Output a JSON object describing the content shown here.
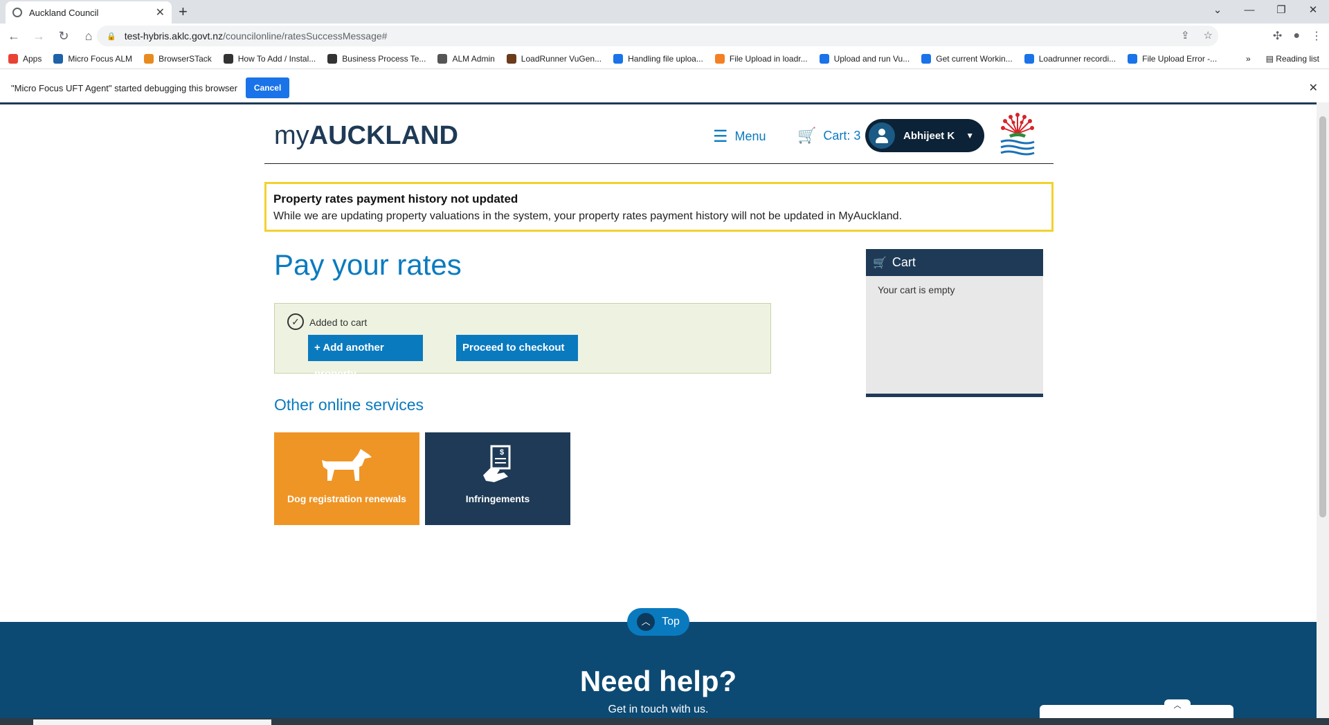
{
  "browser": {
    "tab_title": "Auckland Council",
    "url_host": "test-hybris.aklc.govt.nz",
    "url_path": "/councilonline/ratesSuccessMessage#",
    "bookmarks": [
      {
        "label": "Apps",
        "color": "#e94235"
      },
      {
        "label": "Micro Focus ALM",
        "color": "#1f62a8"
      },
      {
        "label": "BrowserSTack",
        "color": "#e88b1f"
      },
      {
        "label": "How To Add / Instal...",
        "color": "#333333"
      },
      {
        "label": "Business Process Te...",
        "color": "#333333"
      },
      {
        "label": "ALM Admin",
        "color": "#555555"
      },
      {
        "label": "LoadRunner VuGen...",
        "color": "#6b3b1a"
      },
      {
        "label": "Handling file uploa...",
        "color": "#1a73e8"
      },
      {
        "label": "File Upload in loadr...",
        "color": "#f48024"
      },
      {
        "label": "Upload and run Vu...",
        "color": "#1a73e8"
      },
      {
        "label": "Get current Workin...",
        "color": "#1a73e8"
      },
      {
        "label": "Loadrunner recordi...",
        "color": "#1a73e8"
      },
      {
        "label": "File Upload Error -...",
        "color": "#1a73e8"
      }
    ],
    "bookmarks_more": "»",
    "reading_list": "Reading list",
    "infobar_text": "\"Micro Focus UFT Agent\" started debugging this browser",
    "infobar_cancel": "Cancel"
  },
  "site": {
    "logo_prefix": "my",
    "logo_bold": "AUCKLAND",
    "menu_label": "Menu",
    "cart_label": "Cart: 3",
    "user_name": "Abhijeet K",
    "alert_title": "Property rates payment history not updated",
    "alert_text": "While we are updating property valuations in the system, your property rates payment history will not be updated in MyAuckland.",
    "page_title": "Pay your rates",
    "success_message": "Added to cart",
    "add_property_label": "Add another property",
    "add_property_plus": "+",
    "checkout_label": "Proceed to checkout",
    "other_services_heading": "Other online services",
    "tiles": [
      {
        "label": "Dog registration renewals",
        "icon": "dog-icon"
      },
      {
        "label": "Infringements",
        "icon": "infringement-document-icon"
      }
    ],
    "cart_panel_title": "Cart",
    "cart_empty_text": "Your cart is empty",
    "top_button": "Top",
    "footer_heading": "Need help?",
    "footer_sub": "Get in touch with us.",
    "colors": {
      "primary_blue": "#0a7abf",
      "navy": "#1e3a56",
      "orange": "#ef9525",
      "alert_yellow": "#f2d22e",
      "success_bg": "#eef3e1"
    }
  }
}
